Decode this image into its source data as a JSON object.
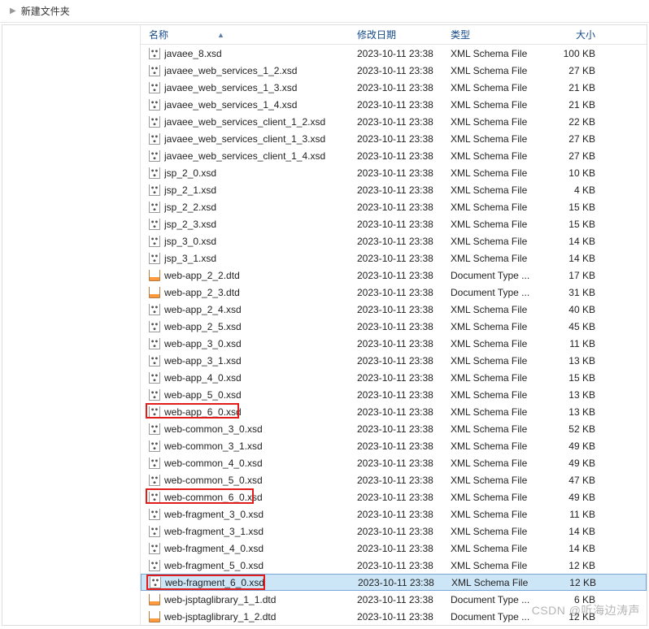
{
  "breadcrumb": {
    "label": "新建文件夹"
  },
  "columns": {
    "name": "名称",
    "date": "修改日期",
    "type": "类型",
    "size": "大小"
  },
  "watermark": "CSDN @听海边涛声",
  "files": [
    {
      "name": "javaee_8.xsd",
      "date": "2023-10-11 23:38",
      "type": "XML Schema File",
      "size": "100 KB",
      "icon": "xsd"
    },
    {
      "name": "javaee_web_services_1_2.xsd",
      "date": "2023-10-11 23:38",
      "type": "XML Schema File",
      "size": "27 KB",
      "icon": "xsd"
    },
    {
      "name": "javaee_web_services_1_3.xsd",
      "date": "2023-10-11 23:38",
      "type": "XML Schema File",
      "size": "21 KB",
      "icon": "xsd"
    },
    {
      "name": "javaee_web_services_1_4.xsd",
      "date": "2023-10-11 23:38",
      "type": "XML Schema File",
      "size": "21 KB",
      "icon": "xsd"
    },
    {
      "name": "javaee_web_services_client_1_2.xsd",
      "date": "2023-10-11 23:38",
      "type": "XML Schema File",
      "size": "22 KB",
      "icon": "xsd"
    },
    {
      "name": "javaee_web_services_client_1_3.xsd",
      "date": "2023-10-11 23:38",
      "type": "XML Schema File",
      "size": "27 KB",
      "icon": "xsd"
    },
    {
      "name": "javaee_web_services_client_1_4.xsd",
      "date": "2023-10-11 23:38",
      "type": "XML Schema File",
      "size": "27 KB",
      "icon": "xsd"
    },
    {
      "name": "jsp_2_0.xsd",
      "date": "2023-10-11 23:38",
      "type": "XML Schema File",
      "size": "10 KB",
      "icon": "xsd"
    },
    {
      "name": "jsp_2_1.xsd",
      "date": "2023-10-11 23:38",
      "type": "XML Schema File",
      "size": "4 KB",
      "icon": "xsd"
    },
    {
      "name": "jsp_2_2.xsd",
      "date": "2023-10-11 23:38",
      "type": "XML Schema File",
      "size": "15 KB",
      "icon": "xsd"
    },
    {
      "name": "jsp_2_3.xsd",
      "date": "2023-10-11 23:38",
      "type": "XML Schema File",
      "size": "15 KB",
      "icon": "xsd"
    },
    {
      "name": "jsp_3_0.xsd",
      "date": "2023-10-11 23:38",
      "type": "XML Schema File",
      "size": "14 KB",
      "icon": "xsd"
    },
    {
      "name": "jsp_3_1.xsd",
      "date": "2023-10-11 23:38",
      "type": "XML Schema File",
      "size": "14 KB",
      "icon": "xsd"
    },
    {
      "name": "web-app_2_2.dtd",
      "date": "2023-10-11 23:38",
      "type": "Document Type ...",
      "size": "17 KB",
      "icon": "dtd"
    },
    {
      "name": "web-app_2_3.dtd",
      "date": "2023-10-11 23:38",
      "type": "Document Type ...",
      "size": "31 KB",
      "icon": "dtd"
    },
    {
      "name": "web-app_2_4.xsd",
      "date": "2023-10-11 23:38",
      "type": "XML Schema File",
      "size": "40 KB",
      "icon": "xsd"
    },
    {
      "name": "web-app_2_5.xsd",
      "date": "2023-10-11 23:38",
      "type": "XML Schema File",
      "size": "45 KB",
      "icon": "xsd"
    },
    {
      "name": "web-app_3_0.xsd",
      "date": "2023-10-11 23:38",
      "type": "XML Schema File",
      "size": "11 KB",
      "icon": "xsd"
    },
    {
      "name": "web-app_3_1.xsd",
      "date": "2023-10-11 23:38",
      "type": "XML Schema File",
      "size": "13 KB",
      "icon": "xsd"
    },
    {
      "name": "web-app_4_0.xsd",
      "date": "2023-10-11 23:38",
      "type": "XML Schema File",
      "size": "15 KB",
      "icon": "xsd"
    },
    {
      "name": "web-app_5_0.xsd",
      "date": "2023-10-11 23:38",
      "type": "XML Schema File",
      "size": "13 KB",
      "icon": "xsd"
    },
    {
      "name": "web-app_6_0.xsd",
      "date": "2023-10-11 23:38",
      "type": "XML Schema File",
      "size": "13 KB",
      "icon": "xsd",
      "highlight": true
    },
    {
      "name": "web-common_3_0.xsd",
      "date": "2023-10-11 23:38",
      "type": "XML Schema File",
      "size": "52 KB",
      "icon": "xsd"
    },
    {
      "name": "web-common_3_1.xsd",
      "date": "2023-10-11 23:38",
      "type": "XML Schema File",
      "size": "49 KB",
      "icon": "xsd"
    },
    {
      "name": "web-common_4_0.xsd",
      "date": "2023-10-11 23:38",
      "type": "XML Schema File",
      "size": "49 KB",
      "icon": "xsd"
    },
    {
      "name": "web-common_5_0.xsd",
      "date": "2023-10-11 23:38",
      "type": "XML Schema File",
      "size": "47 KB",
      "icon": "xsd"
    },
    {
      "name": "web-common_6_0.xsd",
      "date": "2023-10-11 23:38",
      "type": "XML Schema File",
      "size": "49 KB",
      "icon": "xsd",
      "highlight": true
    },
    {
      "name": "web-fragment_3_0.xsd",
      "date": "2023-10-11 23:38",
      "type": "XML Schema File",
      "size": "11 KB",
      "icon": "xsd"
    },
    {
      "name": "web-fragment_3_1.xsd",
      "date": "2023-10-11 23:38",
      "type": "XML Schema File",
      "size": "14 KB",
      "icon": "xsd"
    },
    {
      "name": "web-fragment_4_0.xsd",
      "date": "2023-10-11 23:38",
      "type": "XML Schema File",
      "size": "14 KB",
      "icon": "xsd"
    },
    {
      "name": "web-fragment_5_0.xsd",
      "date": "2023-10-11 23:38",
      "type": "XML Schema File",
      "size": "12 KB",
      "icon": "xsd"
    },
    {
      "name": "web-fragment_6_0.xsd",
      "date": "2023-10-11 23:38",
      "type": "XML Schema File",
      "size": "12 KB",
      "icon": "xsd",
      "highlight": true,
      "selected": true
    },
    {
      "name": "web-jsptaglibrary_1_1.dtd",
      "date": "2023-10-11 23:38",
      "type": "Document Type ...",
      "size": "6 KB",
      "icon": "dtd"
    },
    {
      "name": "web-jsptaglibrary_1_2.dtd",
      "date": "2023-10-11 23:38",
      "type": "Document Type ...",
      "size": "12 KB",
      "icon": "dtd"
    }
  ]
}
